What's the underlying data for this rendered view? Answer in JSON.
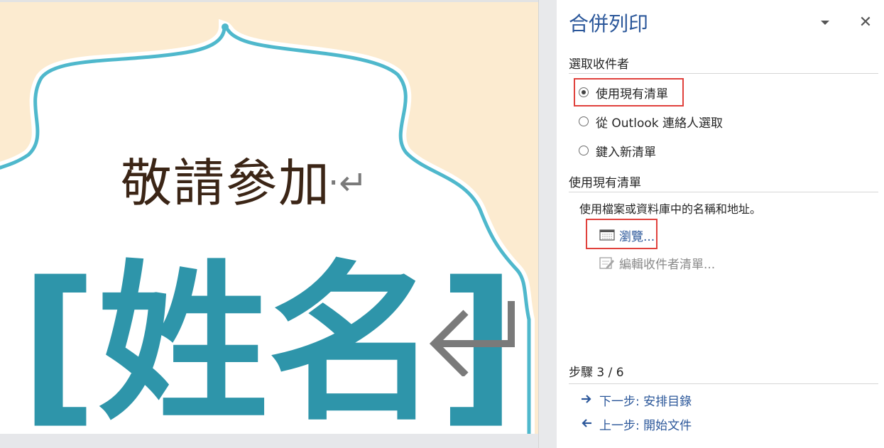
{
  "document": {
    "invite_text": "敬請參加",
    "name_field": "[姓名]",
    "pilcrow_small": "·↵"
  },
  "pane": {
    "title": "合併列印",
    "close_glyph": "✕",
    "select_recipients": {
      "heading": "選取收件者",
      "options": [
        {
          "label": "使用現有清單",
          "checked": true
        },
        {
          "label": "從 Outlook 連絡人選取",
          "checked": false
        },
        {
          "label": "鍵入新清單",
          "checked": false
        }
      ]
    },
    "existing_list": {
      "heading": "使用現有清單",
      "description": "使用檔案或資料庫中的名稱和地址。",
      "browse_label": "瀏覽...",
      "edit_label": "編輯收件者清單..."
    },
    "step": {
      "label": "步驟 3 / 6",
      "next_label": "下一步: 安排目錄",
      "prev_label": "上一步: 開始文件",
      "next_icon": "arrow-right-icon",
      "prev_icon": "arrow-left-icon"
    }
  },
  "colors": {
    "accent": "#2b579a",
    "name_field": "#2e95aa",
    "frame_stroke": "#4fb8cc",
    "page_background": "#fcebd0",
    "highlight_box": "#e0413c"
  }
}
